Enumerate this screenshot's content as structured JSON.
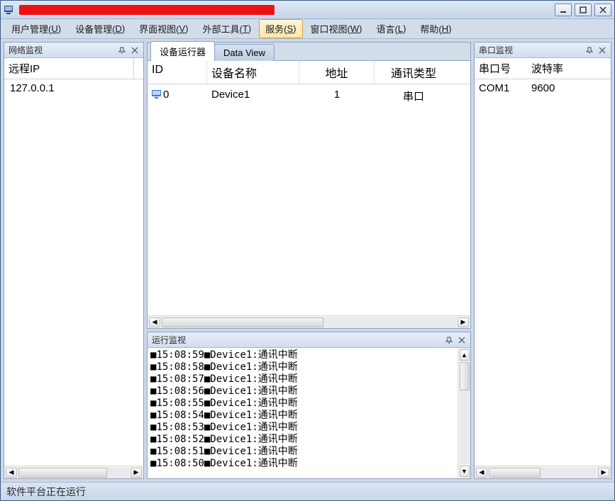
{
  "title_redacted": true,
  "menubar": [
    {
      "label": "用户管理",
      "accel": "U",
      "active": false
    },
    {
      "label": "设备管理",
      "accel": "D",
      "active": false
    },
    {
      "label": "界面视图",
      "accel": "V",
      "active": false
    },
    {
      "label": "外部工具",
      "accel": "T",
      "active": false
    },
    {
      "label": "服务",
      "accel": "S",
      "active": true
    },
    {
      "label": "窗口视图",
      "accel": "W",
      "active": false
    },
    {
      "label": "语言",
      "accel": "L",
      "active": false
    },
    {
      "label": "帮助",
      "accel": "H",
      "active": false
    }
  ],
  "panels": {
    "network": {
      "title": "网络监视",
      "header": "远程IP",
      "rows": [
        "127.0.0.1"
      ]
    },
    "serial": {
      "title": "串口监视",
      "cols": [
        "串口号",
        "波特率"
      ],
      "rows": [
        {
          "port": "COM1",
          "baud": "9600"
        }
      ]
    },
    "run": {
      "title": "运行监视"
    }
  },
  "doc_tabs": [
    {
      "label": "设备运行器",
      "active": true
    },
    {
      "label": "Data View",
      "active": false
    }
  ],
  "device_table": {
    "cols": [
      "ID",
      "设备名称",
      "地址",
      "通讯类型"
    ],
    "rows": [
      {
        "id": "0",
        "name": "Device1",
        "addr": "1",
        "type": "串口"
      }
    ]
  },
  "log_lines": [
    {
      "time": "15:08:59",
      "dev": "Device1",
      "msg": "通讯中断"
    },
    {
      "time": "15:08:58",
      "dev": "Device1",
      "msg": "通讯中断"
    },
    {
      "time": "15:08:57",
      "dev": "Device1",
      "msg": "通讯中断"
    },
    {
      "time": "15:08:56",
      "dev": "Device1",
      "msg": "通讯中断"
    },
    {
      "time": "15:08:55",
      "dev": "Device1",
      "msg": "通讯中断"
    },
    {
      "time": "15:08:54",
      "dev": "Device1",
      "msg": "通讯中断"
    },
    {
      "time": "15:08:53",
      "dev": "Device1",
      "msg": "通讯中断"
    },
    {
      "time": "15:08:52",
      "dev": "Device1",
      "msg": "通讯中断"
    },
    {
      "time": "15:08:51",
      "dev": "Device1",
      "msg": "通讯中断"
    },
    {
      "time": "15:08:50",
      "dev": "Device1",
      "msg": "通讯中断"
    }
  ],
  "statusbar": "软件平台正在运行"
}
